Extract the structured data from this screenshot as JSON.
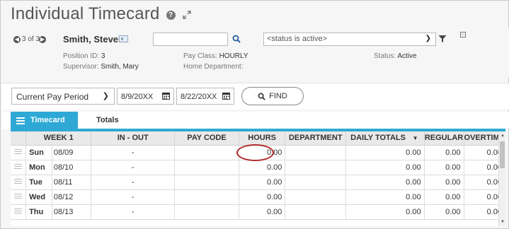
{
  "page": {
    "title": "Individual Timecard",
    "help_icon": "question-circle-icon",
    "expand_icon": "expand-arrows-icon"
  },
  "employee_nav": {
    "prev_icon": "chevron-left-circle-icon",
    "counter": "3 of 3",
    "next_icon": "chevron-right-circle-icon"
  },
  "employee": {
    "name": "Smith, Steven",
    "position_label": "Position ID:",
    "position_value": "3",
    "supervisor_label": "Supervisor:",
    "supervisor_value": "Smith, Mary",
    "pay_class_label": "Pay Class:",
    "pay_class_value": "HOURLY",
    "home_dept_label": "Home Department:",
    "home_dept_value": "",
    "status_label": "Status:",
    "status_value": "Active"
  },
  "search": {
    "value": "",
    "placeholder": ""
  },
  "status_filter": {
    "selected": "<status is active>"
  },
  "toolbar": {
    "period_selected": "Current Pay Period",
    "start_date": "8/9/20XX",
    "end_date": "8/22/20XX",
    "find_label": "FIND"
  },
  "tabs": [
    {
      "label": "Timecard",
      "active": true
    },
    {
      "label": "Totals",
      "active": false
    }
  ],
  "grid": {
    "columns": [
      "WEEK 1",
      "IN - OUT",
      "PAY CODE",
      "HOURS",
      "DEPARTMENT",
      "DAILY TOTALS",
      "REGULAR",
      "OVERTIME"
    ],
    "rows": [
      {
        "day": "Sun",
        "date": "08/09",
        "in_out": "-",
        "pay_code": "",
        "hours": "0.00",
        "department": "",
        "daily_total": "0.00",
        "regular": "0.00",
        "overtime": "0.00"
      },
      {
        "day": "Mon",
        "date": "08/10",
        "in_out": "-",
        "pay_code": "",
        "hours": "0.00",
        "department": "",
        "daily_total": "0.00",
        "regular": "0.00",
        "overtime": "0.00"
      },
      {
        "day": "Tue",
        "date": "08/11",
        "in_out": "-",
        "pay_code": "",
        "hours": "0.00",
        "department": "",
        "daily_total": "0.00",
        "regular": "0.00",
        "overtime": "0.00"
      },
      {
        "day": "Wed",
        "date": "08/12",
        "in_out": "-",
        "pay_code": "",
        "hours": "0.00",
        "department": "",
        "daily_total": "0.00",
        "regular": "0.00",
        "overtime": "0.00"
      },
      {
        "day": "Thu",
        "date": "08/13",
        "in_out": "-",
        "pay_code": "",
        "hours": "0.00",
        "department": "",
        "daily_total": "0.00",
        "regular": "0.00",
        "overtime": "0.00"
      }
    ]
  },
  "colors": {
    "accent": "#2ea9d6",
    "highlight_circle": "#b02a2a"
  }
}
